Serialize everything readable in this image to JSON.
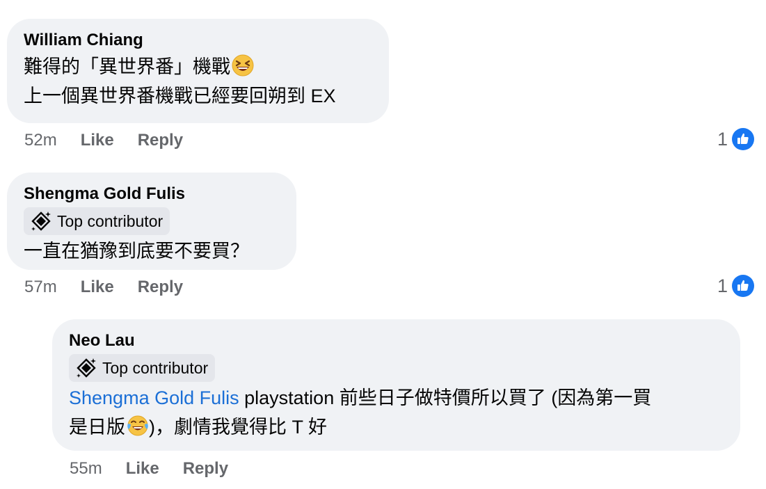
{
  "comments": [
    {
      "author": "William  Chiang",
      "lines": [
        "難得的「異世界番」機戰",
        "上一個異世界番機戰已經要回朔到 EX"
      ],
      "emoji": "grinning-squinting-face",
      "time": "52m",
      "like_label": "Like",
      "reply_label": "Reply",
      "reaction_count": "1"
    },
    {
      "author": "Shengma Gold Fulis",
      "badge": "Top contributor",
      "lines": [
        "一直在猶豫到底要不要買？"
      ],
      "time": "57m",
      "like_label": "Like",
      "reply_label": "Reply",
      "reaction_count": "1"
    },
    {
      "author": "Neo Lau",
      "badge": "Top contributor",
      "mention": "Shengma Gold Fulis",
      "line1_rest": " playstation 前些日子做特價所以買了 (因為第一買",
      "line2_pre": "是日版",
      "line2_post": ")，劇情我覺得比 T 好",
      "emoji": "face-with-tears-of-joy",
      "time": "55m",
      "like_label": "Like",
      "reply_label": "Reply"
    }
  ],
  "colors": {
    "bubble": "#f0f2f5",
    "badge": "#e4e6eb",
    "mention": "#1b6fd6",
    "meta": "#65676b",
    "like_blue": "#1877f2"
  }
}
